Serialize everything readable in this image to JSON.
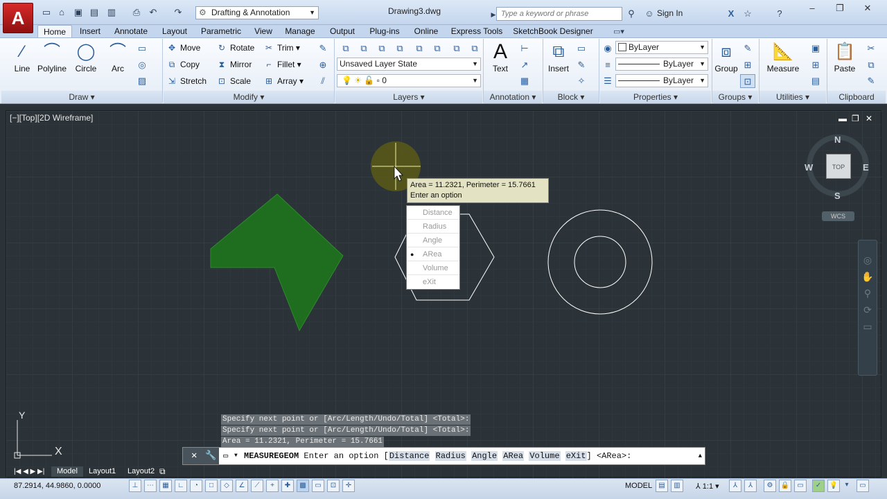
{
  "title_bar": {
    "app_button": "A",
    "workspace": "Drafting & Annotation",
    "document": "Drawing3.dwg",
    "search_placeholder": "Type a keyword or phrase",
    "sign_in": "Sign In"
  },
  "tabs": [
    "Home",
    "Insert",
    "Annotate",
    "Layout",
    "Parametric",
    "View",
    "Manage",
    "Output",
    "Plug-ins",
    "Online",
    "Express Tools",
    "SketchBook Designer"
  ],
  "ribbon": {
    "draw": {
      "title": "Draw",
      "line": "Line",
      "polyline": "Polyline",
      "circle": "Circle",
      "arc": "Arc"
    },
    "modify": {
      "title": "Modify",
      "move": "Move",
      "rotate": "Rotate",
      "trim": "Trim",
      "copy": "Copy",
      "mirror": "Mirror",
      "fillet": "Fillet",
      "stretch": "Stretch",
      "scale": "Scale",
      "array": "Array"
    },
    "layers": {
      "title": "Layers",
      "layer_state": "Unsaved Layer State",
      "current_layer": "0"
    },
    "annotation": {
      "title": "Annotation",
      "text": "Text"
    },
    "block": {
      "title": "Block",
      "insert": "Insert"
    },
    "properties": {
      "title": "Properties",
      "color": "ByLayer",
      "linetype": "ByLayer",
      "lineweight": "ByLayer"
    },
    "groups": {
      "title": "Groups",
      "group": "Group"
    },
    "utilities": {
      "title": "Utilities",
      "measure": "Measure"
    },
    "clipboard": {
      "title": "Clipboard",
      "paste": "Paste"
    }
  },
  "viewport": {
    "label": "[−][Top][2D Wireframe]",
    "compass": {
      "n": "N",
      "s": "S",
      "e": "E",
      "w": "W",
      "top": "TOP"
    },
    "wcs": "WCS",
    "ucs": {
      "x": "X",
      "y": "Y"
    }
  },
  "tooltip": {
    "line1": "Area = 11.2321, Perimeter = 15.7661",
    "line2": "Enter an option"
  },
  "option_menu": [
    "Distance",
    "Radius",
    "Angle",
    "ARea",
    "Volume",
    "eXit"
  ],
  "option_menu_selected": "ARea",
  "command_history": [
    "Specify next point or [Arc/Length/Undo/Total] <Total>:",
    "Specify next point or [Arc/Length/Undo/Total] <Total>:",
    "Area = 11.2321, Perimeter = 15.7661"
  ],
  "command_line": {
    "command": "MEASUREGEOM",
    "prompt": "Enter an option [",
    "options": [
      "Distance",
      "Radius",
      "Angle",
      "ARea",
      "Volume",
      "eXit"
    ],
    "suffix": "] <ARea>:"
  },
  "layout_tabs": [
    "Model",
    "Layout1",
    "Layout2"
  ],
  "status_bar": {
    "coordinates": "87.2914, 44.9860, 0.0000",
    "space": "MODEL",
    "annotation_scale": "1:1"
  },
  "colors": {
    "canvas": "#2b3338",
    "shape_fill": "#1f6e1f",
    "shape_stroke": "#ffffff",
    "accent": "#2b5d9a"
  }
}
